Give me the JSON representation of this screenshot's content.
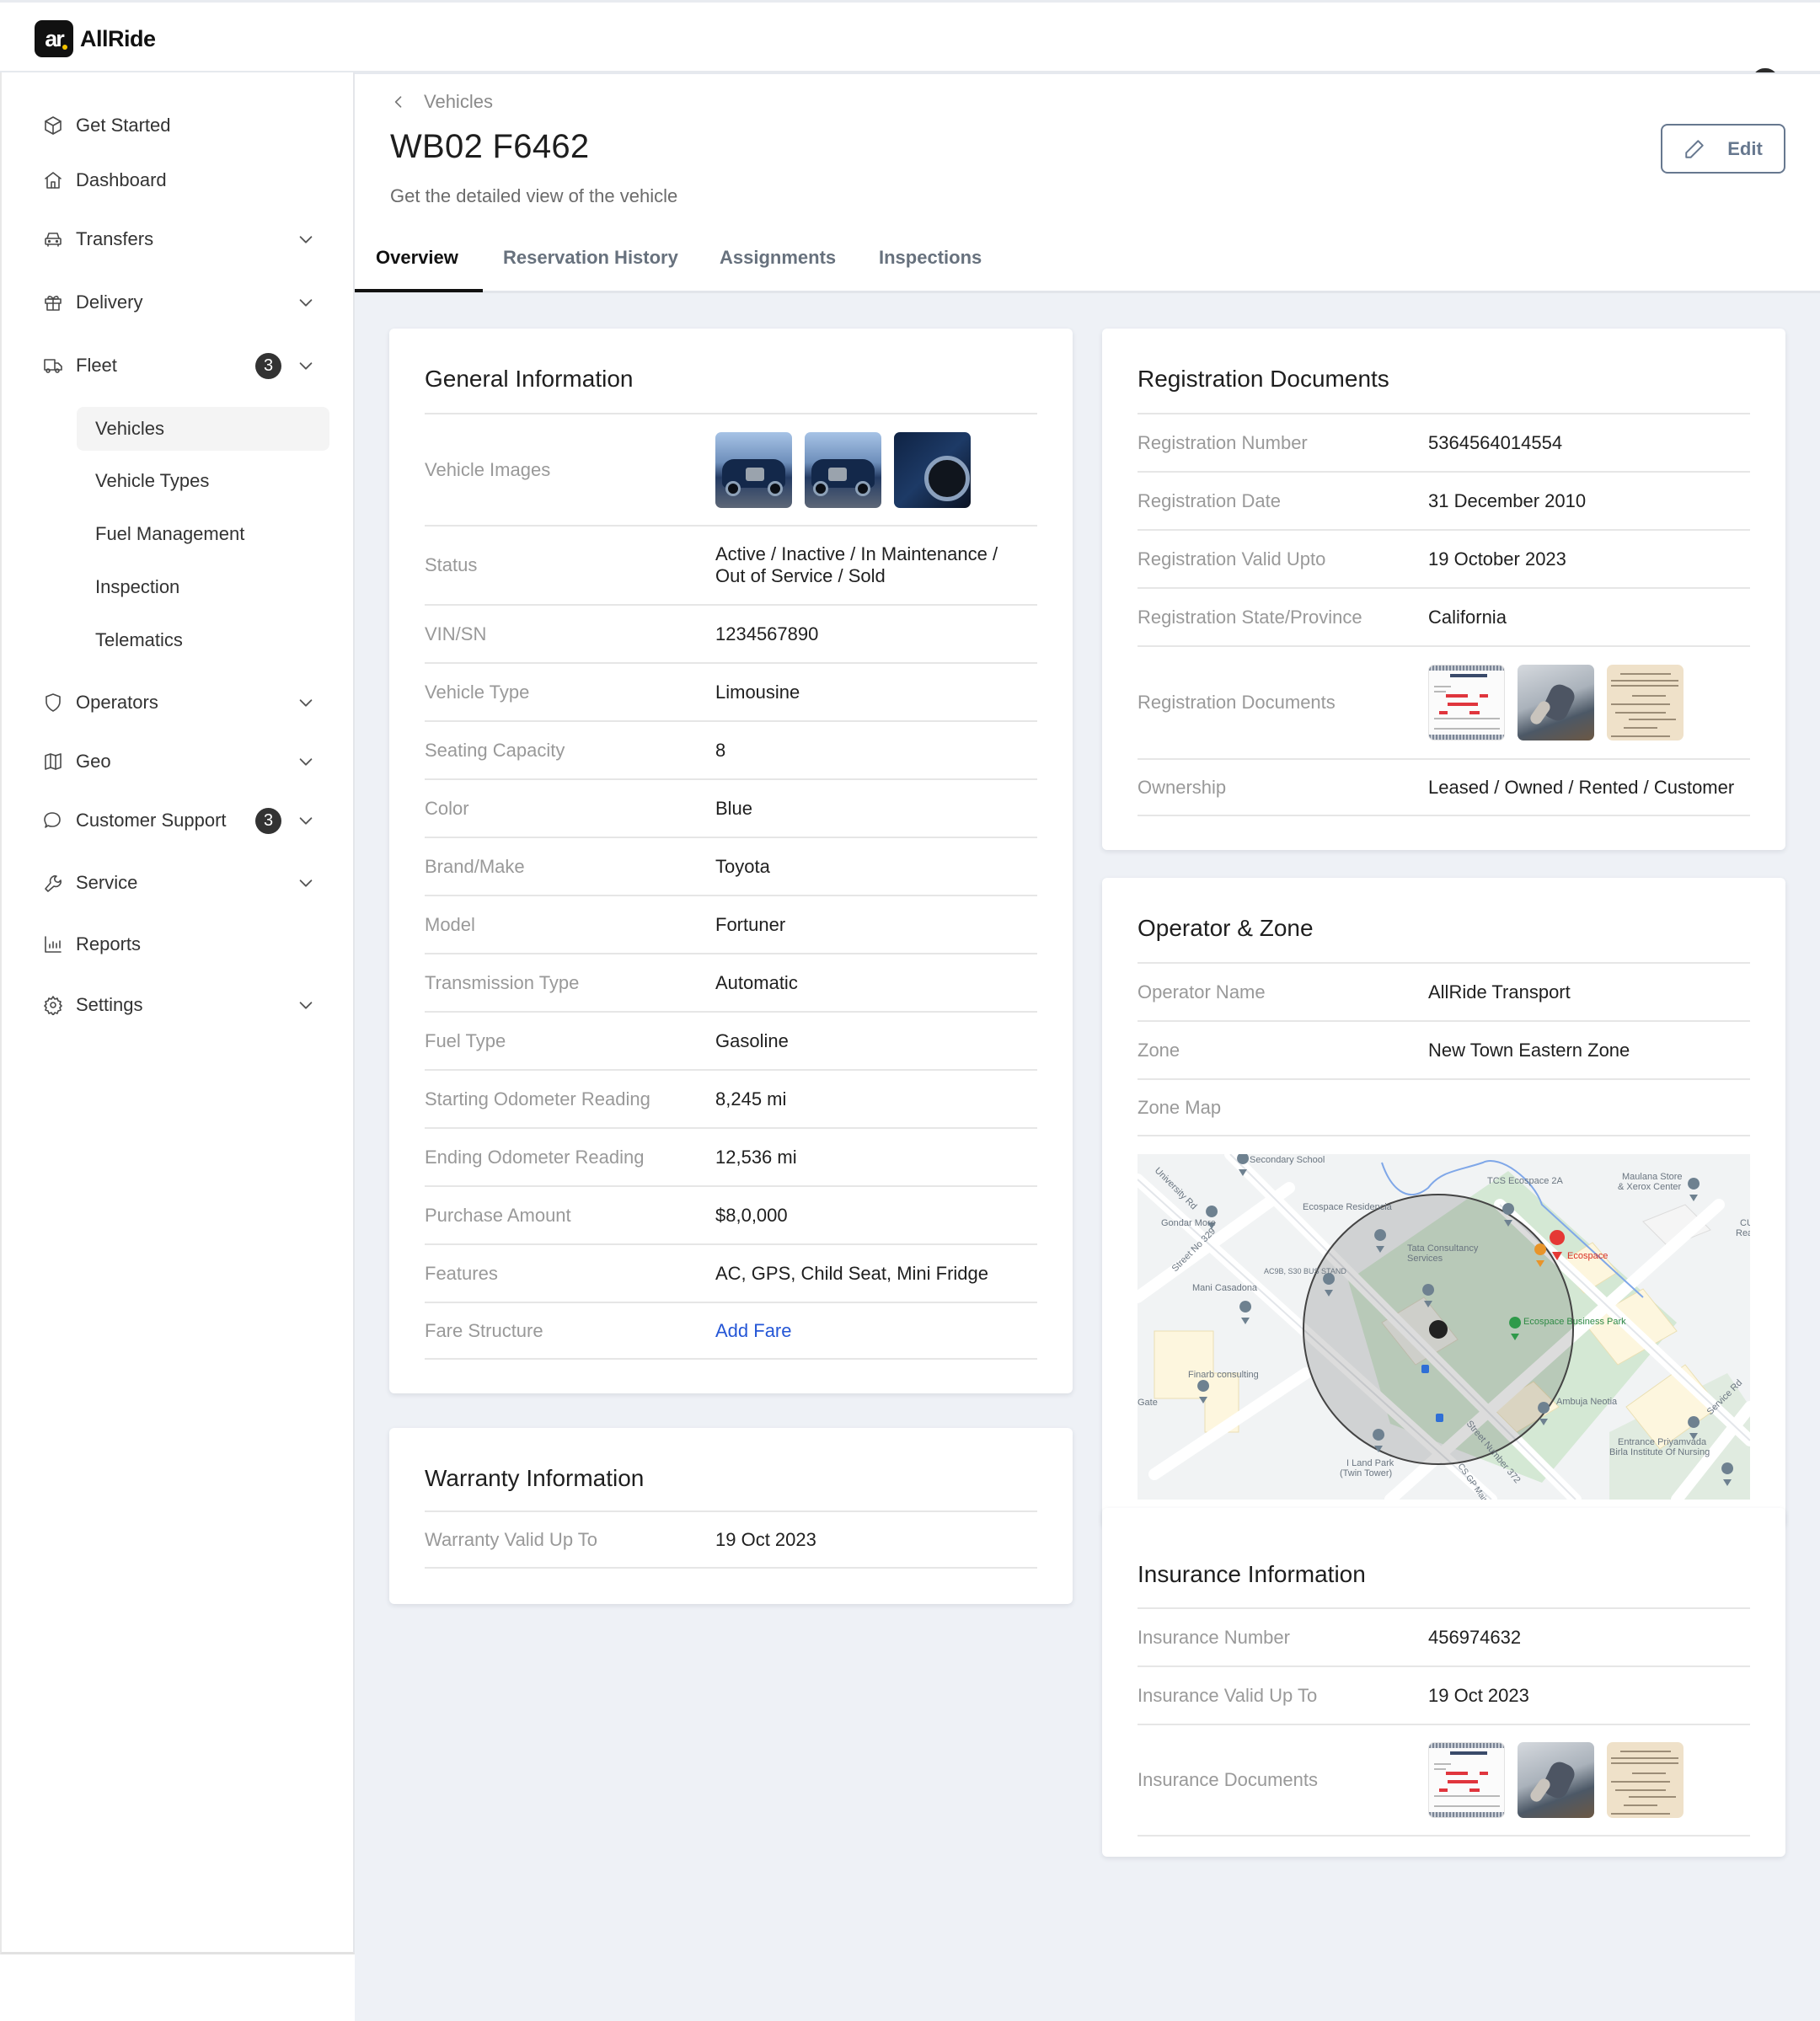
{
  "app": {
    "brand": "AllRide",
    "logo_mark": "ar"
  },
  "sidebar": {
    "items": [
      {
        "label": "Get Started",
        "icon": "cube-icon"
      },
      {
        "label": "Dashboard",
        "icon": "home-icon"
      },
      {
        "label": "Transfers",
        "icon": "car-icon",
        "expandable": true
      },
      {
        "label": "Delivery",
        "icon": "gift-icon",
        "expandable": true
      },
      {
        "label": "Fleet",
        "icon": "truck-icon",
        "expandable": true,
        "badge": "3",
        "expanded": true
      },
      {
        "label": "Operators",
        "icon": "shield-icon",
        "expandable": true
      },
      {
        "label": "Geo",
        "icon": "map-icon",
        "expandable": true
      },
      {
        "label": "Customer Support",
        "icon": "chat-icon",
        "expandable": true,
        "badge": "3"
      },
      {
        "label": "Service",
        "icon": "wrench-icon",
        "expandable": true
      },
      {
        "label": "Reports",
        "icon": "bar-chart-icon"
      },
      {
        "label": "Settings",
        "icon": "gear-icon",
        "expandable": true
      }
    ],
    "fleet_subitems": [
      {
        "label": "Vehicles",
        "active": true
      },
      {
        "label": "Vehicle Types"
      },
      {
        "label": "Fuel Management"
      },
      {
        "label": "Inspection"
      },
      {
        "label": "Telematics"
      }
    ]
  },
  "page": {
    "breadcrumb": "Vehicles",
    "title": "WB02 F6462",
    "subtitle": "Get the detailed view of the vehicle",
    "edit_label": "Edit",
    "tabs": [
      {
        "label": "Overview",
        "active": true
      },
      {
        "label": "Reservation History"
      },
      {
        "label": "Assignments"
      },
      {
        "label": "Inspections"
      }
    ]
  },
  "general_info": {
    "title": "General Information",
    "rows": [
      {
        "label": "Vehicle Images",
        "type": "images",
        "images": [
          "car-front-left",
          "car-front-right",
          "car-wheel"
        ]
      },
      {
        "label": "Status",
        "value": "Active / Inactive / In Maintenance / Out of Service / Sold"
      },
      {
        "label": "VIN/SN",
        "value": "1234567890"
      },
      {
        "label": "Vehicle Type",
        "value": "Limousine"
      },
      {
        "label": "Seating Capacity",
        "value": "8"
      },
      {
        "label": "Color",
        "value": "Blue"
      },
      {
        "label": "Brand/Make",
        "value": "Toyota"
      },
      {
        "label": "Model",
        "value": "Fortuner"
      },
      {
        "label": "Transmission Type",
        "value": "Automatic"
      },
      {
        "label": "Fuel Type",
        "value": "Gasoline"
      },
      {
        "label": "Starting Odometer Reading",
        "value": "8,245 mi"
      },
      {
        "label": "Ending Odometer Reading",
        "value": "12,536 mi"
      },
      {
        "label": "Purchase Amount",
        "value": "$8,0,000"
      },
      {
        "label": "Features",
        "value": "AC, GPS, Child Seat, Mini Fridge"
      },
      {
        "label": "Fare Structure",
        "value": "Add Fare",
        "link": true
      }
    ]
  },
  "warranty": {
    "title": "Warranty Information",
    "rows": [
      {
        "label": "Warranty Valid Up To",
        "value": "19 Oct 2023"
      }
    ]
  },
  "registration": {
    "title": "Registration Documents",
    "rows": [
      {
        "label": "Registration Number",
        "value": "5364564014554"
      },
      {
        "label": "Registration Date",
        "value": "31 December 2010"
      },
      {
        "label": "Registration Valid Upto",
        "value": "19 October 2023"
      },
      {
        "label": "Registration State/Province",
        "value": "California"
      },
      {
        "label": "Registration Documents",
        "type": "images",
        "images": [
          "proof-of-ownership",
          "car-keys",
          "kansas-automobile-license"
        ]
      },
      {
        "label": "Ownership",
        "value": "Leased / Owned / Rented / Customer"
      }
    ]
  },
  "operator_zone": {
    "title": "Operator & Zone",
    "rows": [
      {
        "label": "Operator Name",
        "value": "AllRide Transport"
      },
      {
        "label": "Zone",
        "value": "New Town Eastern Zone"
      },
      {
        "label": "Zone Map",
        "value": ""
      }
    ],
    "map": {
      "labels": {
        "secondary_school": "Secondary School",
        "university_rd": "University Rd",
        "gondar_more": "Gondar More",
        "street_329": "Street No 329",
        "ecospace_residencia": "Ecospace Residencia",
        "tcs_ecospace": "TCS Ecospace 2A",
        "maulana_store": "Maulana Store",
        "xerox_center": "& Xerox Center",
        "bus_stand": "AC9B, S30 BUS STAND",
        "tata_1": "Tata Consultancy",
        "tata_2": "Services",
        "ecospace": "Ecospace",
        "mani_casadona": "Mani Casadona",
        "ecospace_bp": "Ecospace Business Park",
        "finarb": "Finarb consulting",
        "ambuja": "Ambuja Neotia",
        "service_rd": "Service Rd",
        "street_372": "Street Number 372",
        "iland_1": "I Land Park",
        "iland_2": "(Twin Tower)",
        "priyamvada_1": "Entrance Priyamvada",
        "priyamvada_2": "Birla Institute Of Nursing",
        "cs_gp": "CS GP Main",
        "cu": "CU",
        "real": "Real",
        "gate": "Gate"
      }
    }
  },
  "insurance": {
    "title": "Insurance Information",
    "rows": [
      {
        "label": "Insurance Number",
        "value": "456974632"
      },
      {
        "label": "Insurance Valid Up To",
        "value": "19 Oct 2023"
      },
      {
        "label": "Insurance Documents",
        "type": "images",
        "images": [
          "proof-of-ownership",
          "car-keys",
          "kansas-automobile-license"
        ]
      }
    ]
  },
  "colors": {
    "link": "#2456d6",
    "badge_bg": "#333333",
    "page_bg": "#eef1f6",
    "edit_button": "#67788f"
  }
}
